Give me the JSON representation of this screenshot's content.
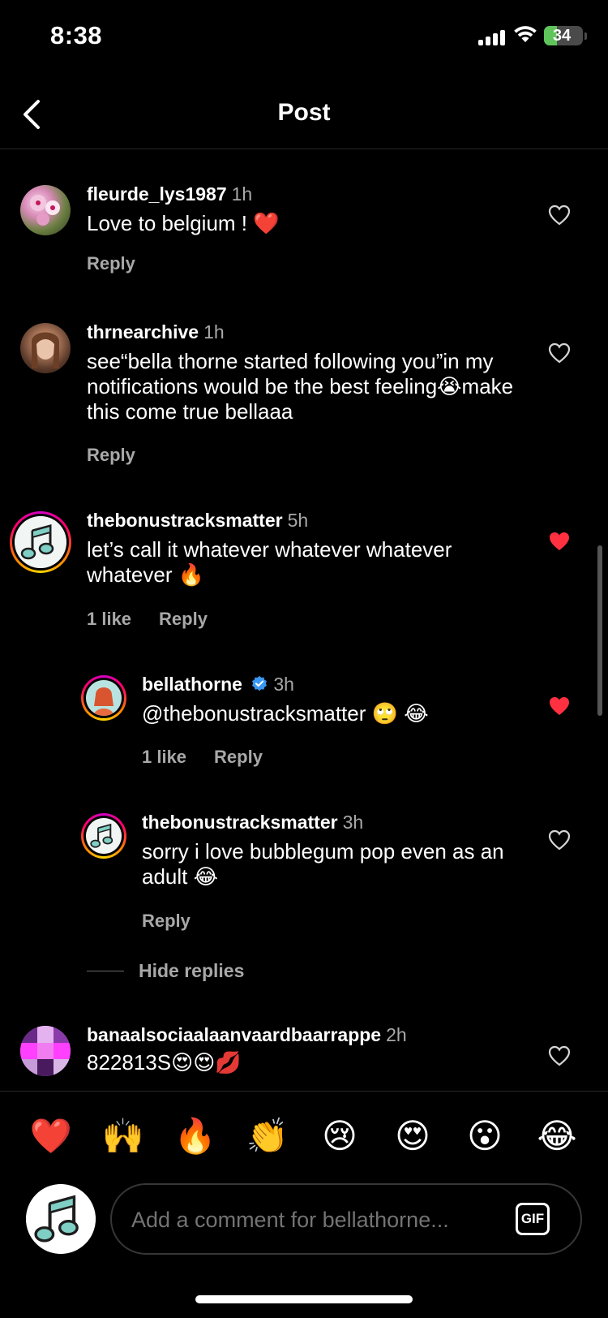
{
  "status_bar": {
    "time": "8:38",
    "battery": "34"
  },
  "nav": {
    "title": "Post"
  },
  "comments": [
    {
      "username": "fleurde_lys1987",
      "time": "1h",
      "text": "Love to belgium ! ❤️",
      "reply_label": "Reply",
      "liked": false
    },
    {
      "username": "thrnearchive",
      "time": "1h",
      "text": "see“bella thorne started following you”in my notifications would be the best feeling😭make this come true bellaaa",
      "reply_label": "Reply",
      "liked": false
    },
    {
      "username": "thebonustracksmatter",
      "time": "5h",
      "text": "let’s call it whatever whatever whatever whatever 🔥",
      "likes": "1 like",
      "reply_label": "Reply",
      "liked": true
    },
    {
      "username": "bellathorne",
      "time": "3h",
      "text": "@thebonustracksmatter 🙄 😂",
      "likes": "1 like",
      "reply_label": "Reply",
      "liked": true,
      "verified": true
    },
    {
      "username": "thebonustracksmatter",
      "time": "3h",
      "text": "sorry i love bubblegum pop even as an adult 😂",
      "reply_label": "Reply",
      "liked": false
    },
    {
      "username": "banaalsociaalaanvaardbaarrappe",
      "time": "2h",
      "text": "822813S😍😍💋",
      "liked": false
    }
  ],
  "hide_replies": "Hide replies",
  "quick_emojis": [
    "❤️",
    "🙌",
    "🔥",
    "👏",
    "😢",
    "😍",
    "😮",
    "😂"
  ],
  "composer": {
    "placeholder": "Add a comment for bellathorne...",
    "gif_label": "GIF"
  },
  "colors": {
    "like_red": "#ff3040",
    "muted": "#a8a8a8",
    "background": "#000000"
  }
}
